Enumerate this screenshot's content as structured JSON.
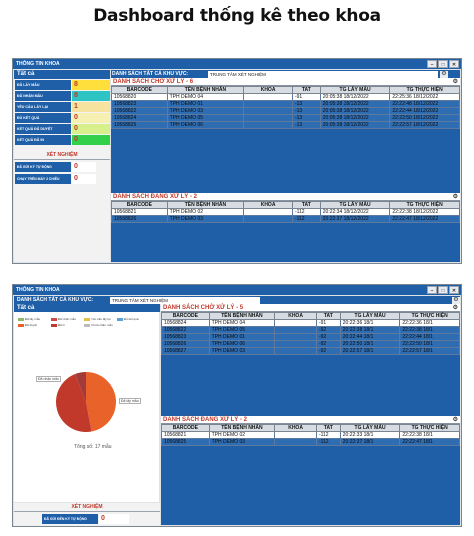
{
  "page_title": "Dashboard thống kê theo khoa",
  "window1": {
    "title": "THÔNG TIN KHOA",
    "tat_ca": "Tất cả",
    "stats": [
      {
        "label": "ĐÃ LẤY MẪU",
        "value": "8",
        "color": "#ffdf3c"
      },
      {
        "label": "ĐÃ NHẬN MẪU",
        "value": "8",
        "color": "#2ec4c4"
      },
      {
        "label": "YÊU CẦU LẤY LẠI",
        "value": "1",
        "color": "#f7e3a0"
      },
      {
        "label": "ĐỦ KẾT QUẢ",
        "value": "0",
        "color": "#f6f0b3"
      },
      {
        "label": "KẾT QUẢ ĐÃ DUYỆT",
        "value": "0",
        "color": "#d7f08c"
      },
      {
        "label": "KẾT QUẢ ĐÃ IN",
        "value": "0",
        "color": "#33d04c"
      }
    ],
    "xet_nghiem": "XÉT NGHIỆM",
    "xn_rows": [
      {
        "label": "ĐÃ GỬI KÝ TỰ ĐỘNG",
        "value": "0"
      },
      {
        "label": "CHẠY TRÊN MÁY 2 CHIỀU",
        "value": "0"
      }
    ],
    "area_label": "DANH SÁCH TẤT CẢ KHU VỰC:",
    "area_value": "TRUNG TÂM XÉT NGHIỆM",
    "panel1_title": "DANH SÁCH CHỜ XỬ LÝ - 6",
    "panel2_title": "DANH SÁCH ĐANG XỬ LÝ - 2",
    "columns": [
      "BARCODE",
      "TÊN BỆNH NHÂN",
      "KHOA",
      "TAT",
      "TG LẤY MẪU",
      "TG THỰC HIỆN"
    ],
    "waiting": [
      [
        "10568820",
        "TPH DEMO 04",
        "",
        "-91",
        "20:05:38 18/12/2022",
        "22:25:36 18/12/2022"
      ],
      [
        "10568823",
        "TPH DEMO 01",
        "",
        "-13",
        "20:05:38 18/12/2022",
        "22:22:48 18/12/2022"
      ],
      [
        "10568822",
        "TPH DEMO 03",
        "",
        "-13",
        "20:05:38 18/12/2022",
        "22:22:44 18/12/2022"
      ],
      [
        "10568824",
        "TPH DEMO 05",
        "",
        "-13",
        "20:05:38 18/12/2022",
        "22:22:50 18/12/2022"
      ],
      [
        "10568825",
        "TPH DEMO 06",
        "",
        "-13",
        "20:05:38 18/12/2022",
        "22:22:57 18/12/2022"
      ]
    ],
    "processing": [
      [
        "10568821",
        "TPH DEMO 02",
        "",
        "-112",
        "20:22:34 18/12/2022",
        "22:22:38 18/12/2022"
      ],
      [
        "10568826",
        "TPH DEMO 03",
        "",
        "-112",
        "20:22:37 18/12/2022",
        "22:22:47 18/12/2022"
      ]
    ]
  },
  "window2": {
    "title": "THÔNG TIN KHOA",
    "area_label": "DANH SÁCH TẤT CẢ KHU VỰC:",
    "area_value": "TRUNG TÂM XÉT NGHIỆM",
    "tat_ca": "Tất cả",
    "legend": [
      "Đã lấy mẫu",
      "Đã nhận mẫu",
      "Yêu cầu lấy lại",
      "Đủ kết quả",
      "Đã duyệt",
      "Đã in",
      "Chưa nhận mẫu"
    ],
    "chart_data": {
      "type": "pie",
      "categories": [
        "Đã lấy mẫu",
        "Đã nhận mẫu",
        "Yêu cầu lấy lại"
      ],
      "values": [
        8,
        8,
        1
      ],
      "colors": [
        "#e8622a",
        "#c0392b",
        "#a23a3a"
      ]
    },
    "callout_left": "Đã nhận mẫu",
    "callout_right": "Đã lấy mẫu",
    "total": "Tổng số: 17 mẫu",
    "xet_nghiem": "XÉT NGHIỆM",
    "xn_label": "ĐÃ GỬI ĐẾN KÝ TỰ ĐỘNG",
    "xn_value": "0",
    "panel1_title": "DANH SÁCH CHỜ XỬ LÝ - 5",
    "panel2_title": "DANH SÁCH ĐANG XỬ LÝ - 2",
    "columns": [
      "BARCODE",
      "TÊN BỆNH NHÂN",
      "KHOA",
      "TAT",
      "TG LẤY MẪU",
      "TG THỰC HIỆN"
    ],
    "waiting": [
      [
        "10568824",
        "TPH DEMO 04",
        "",
        "-91",
        "20:22:36 18/1",
        "22:22:36 18/1"
      ],
      [
        "10568822",
        "TPH DEMO 05",
        "",
        "-92",
        "20:22:38 18/1",
        "22:22:38 18/1"
      ],
      [
        "10568823",
        "TPH DEMO 01",
        "",
        "-92",
        "20:22:44 18/1",
        "22:22:44 18/1"
      ],
      [
        "10568826",
        "TPH DEMO 06",
        "",
        "-92",
        "20:22:50 18/1",
        "22:22:50 18/1"
      ],
      [
        "10568827",
        "TPH DEMO 03",
        "",
        "-92",
        "20:22:57 18/1",
        "22:22:57 18/1"
      ]
    ],
    "processing": [
      [
        "10568821",
        "TPH DEMO 02",
        "",
        "-112",
        "20:22:33 18/1",
        "22:22:38 18/1"
      ],
      [
        "10568825",
        "TPH DEMO 03",
        "",
        "-112",
        "20:22:37 18/1",
        "22:22:47 18/1"
      ]
    ]
  }
}
